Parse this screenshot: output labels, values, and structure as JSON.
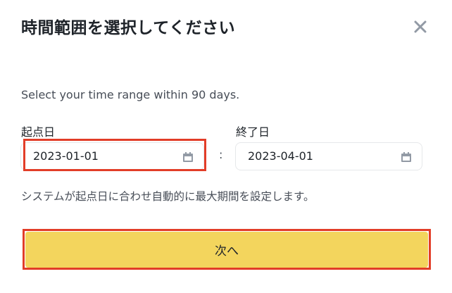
{
  "dialog": {
    "title": "時間範囲を選択してください",
    "subtitle": "Select your time range within 90 days.",
    "start": {
      "label": "起点日",
      "value": "2023-01-01",
      "icon": "calendar-icon"
    },
    "separator": ":",
    "end": {
      "label": "終了日",
      "value": "2023-04-01",
      "icon": "calendar-icon"
    },
    "note": "システムが起点日に合わせ自動的に最大期間を設定します。",
    "next_label": "次へ",
    "close_icon": "close-icon"
  },
  "colors": {
    "accent": "#f3d55d",
    "highlight": "#e23d28",
    "text": "#1e2329",
    "muted": "#474d57",
    "border": "#e6e8ea"
  }
}
